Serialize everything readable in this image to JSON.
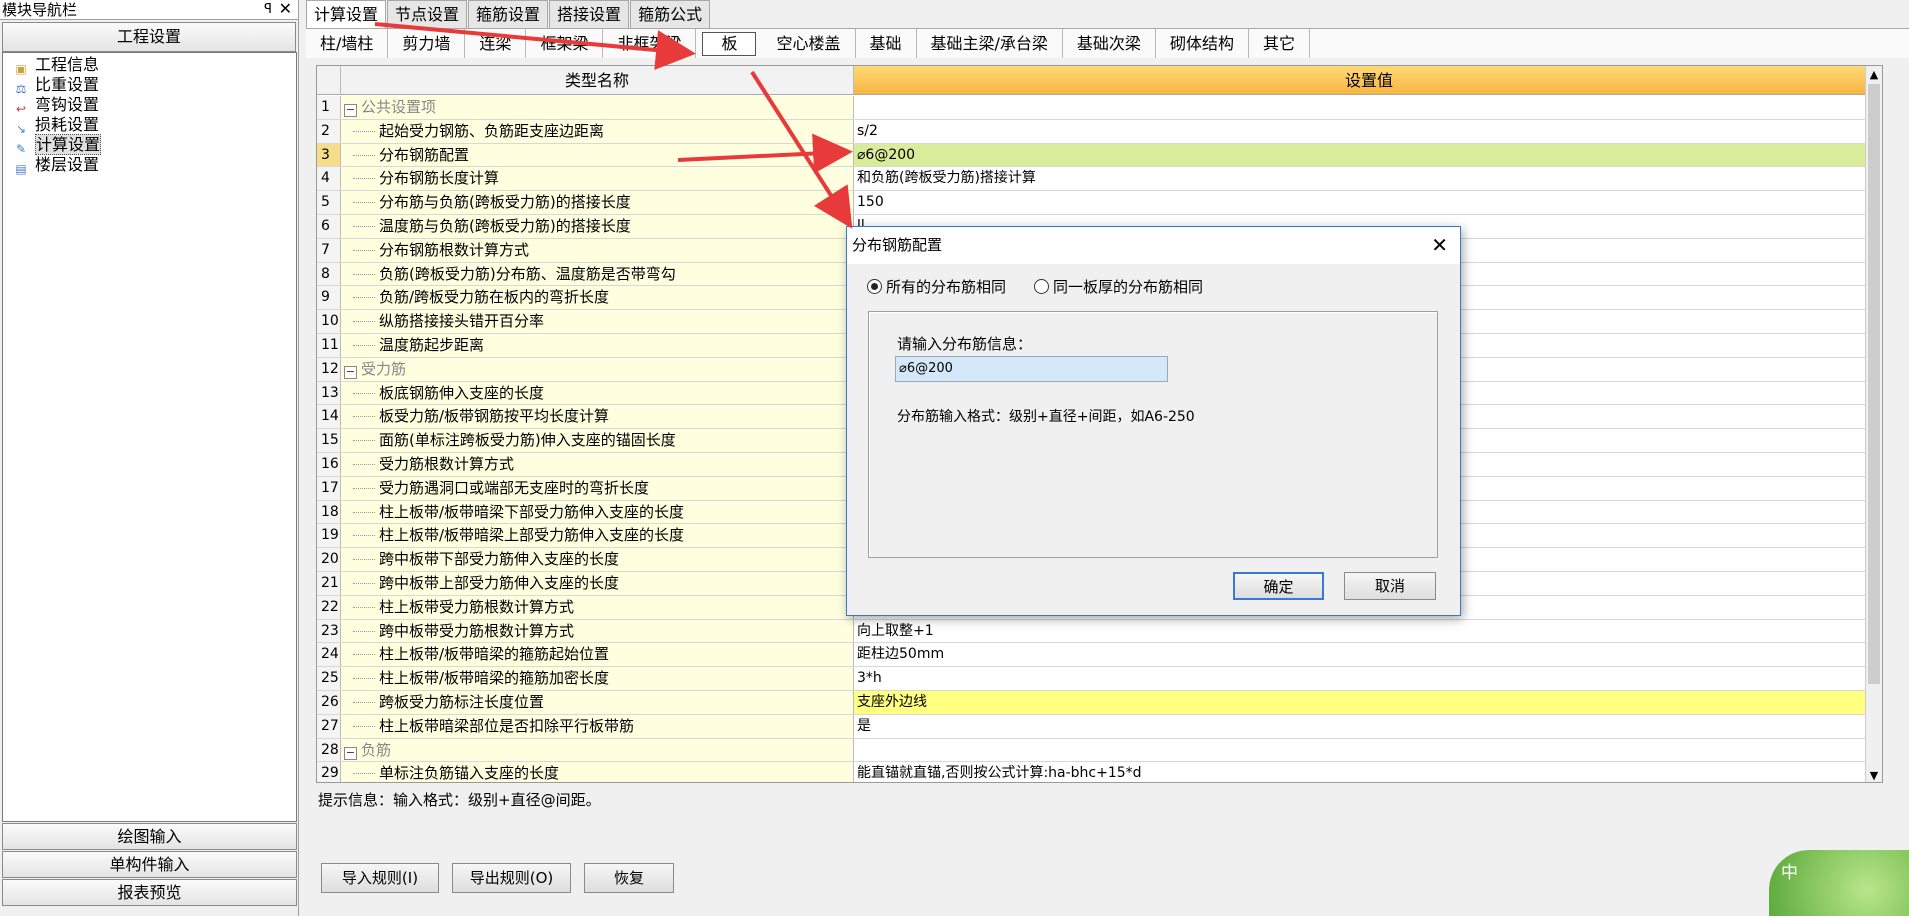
{
  "nav": {
    "title": "模块导航栏",
    "pin": "ꟼ",
    "close": "✕",
    "section": "工程设置",
    "items": [
      {
        "label": "工程信息",
        "icon": "project-info-icon"
      },
      {
        "label": "比重设置",
        "icon": "weight-setting-icon"
      },
      {
        "label": "弯钩设置",
        "icon": "hook-setting-icon"
      },
      {
        "label": "损耗设置",
        "icon": "loss-setting-icon"
      },
      {
        "label": "计算设置",
        "icon": "calc-setting-icon"
      },
      {
        "label": "楼层设置",
        "icon": "floor-setting-icon"
      }
    ],
    "footer": [
      "绘图输入",
      "单构件输入",
      "报表预览"
    ]
  },
  "tabs1": [
    "计算设置",
    "节点设置",
    "箍筋设置",
    "搭接设置",
    "箍筋公式"
  ],
  "tabs2": [
    "柱/墙柱",
    "剪力墙",
    "连梁",
    "框架梁",
    "非框架梁",
    "板",
    "空心楼盖",
    "基础",
    "基础主梁/承台梁",
    "基础次梁",
    "砌体结构",
    "其它"
  ],
  "grid": {
    "col_name": "类型名称",
    "col_value": "设置值",
    "rows": [
      {
        "n": "1",
        "name": "公共设置项",
        "group": true,
        "value": ""
      },
      {
        "n": "2",
        "name": "起始受力钢筋、负筋距支座边距离",
        "value": "s/2"
      },
      {
        "n": "3",
        "name": "分布钢筋配置",
        "value": "⌀6@200",
        "sel": true
      },
      {
        "n": "4",
        "name": "分布钢筋长度计算",
        "value": "和负筋(跨板受力筋)搭接计算"
      },
      {
        "n": "5",
        "name": "分布筋与负筋(跨板受力筋)的搭接长度",
        "value": "150"
      },
      {
        "n": "6",
        "name": "温度筋与负筋(跨板受力筋)的搭接长度",
        "value": "ll"
      },
      {
        "n": "7",
        "name": "分布钢筋根数计算方式",
        "value": ""
      },
      {
        "n": "8",
        "name": "负筋(跨板受力筋)分布筋、温度筋是否带弯勾",
        "value": ""
      },
      {
        "n": "9",
        "name": "负筋/跨板受力筋在板内的弯折长度",
        "value": ""
      },
      {
        "n": "10",
        "name": "纵筋搭接接头错开百分率",
        "value": ""
      },
      {
        "n": "11",
        "name": "温度筋起步距离",
        "value": ""
      },
      {
        "n": "12",
        "name": "受力筋",
        "group": true,
        "value": ""
      },
      {
        "n": "13",
        "name": "板底钢筋伸入支座的长度",
        "value": ""
      },
      {
        "n": "14",
        "name": "板受力筋/板带钢筋按平均长度计算",
        "value": ""
      },
      {
        "n": "15",
        "name": "面筋(单标注跨板受力筋)伸入支座的锚固长度",
        "value": ""
      },
      {
        "n": "16",
        "name": "受力筋根数计算方式",
        "value": ""
      },
      {
        "n": "17",
        "name": "受力筋遇洞口或端部无支座时的弯折长度",
        "value": ""
      },
      {
        "n": "18",
        "name": "柱上板带/板带暗梁下部受力筋伸入支座的长度",
        "value": ""
      },
      {
        "n": "19",
        "name": "柱上板带/板带暗梁上部受力筋伸入支座的长度",
        "value": ""
      },
      {
        "n": "20",
        "name": "跨中板带下部受力筋伸入支座的长度",
        "value": ""
      },
      {
        "n": "21",
        "name": "跨中板带上部受力筋伸入支座的长度",
        "value": ""
      },
      {
        "n": "22",
        "name": "柱上板带受力筋根数计算方式",
        "value": ""
      },
      {
        "n": "23",
        "name": "跨中板带受力筋根数计算方式",
        "value": "向上取整+1"
      },
      {
        "n": "24",
        "name": "柱上板带/板带暗梁的箍筋起始位置",
        "value": "距柱边50mm"
      },
      {
        "n": "25",
        "name": "柱上板带/板带暗梁的箍筋加密长度",
        "value": "3*h"
      },
      {
        "n": "26",
        "name": "跨板受力筋标注长度位置",
        "value": "支座外边线",
        "hl": true
      },
      {
        "n": "27",
        "name": "柱上板带暗梁部位是否扣除平行板带筋",
        "value": "是"
      },
      {
        "n": "28",
        "name": "负筋",
        "group": true,
        "value": ""
      },
      {
        "n": "29",
        "name": "单标注负筋锚入支座的长度",
        "value": "能直锚就直锚,否则按公式计算:ha-bhc+15*d"
      }
    ]
  },
  "hint": "提示信息：输入格式：级别+直径@间距。",
  "buttons": {
    "import": "导入规则(I)",
    "export": "导出规则(O)",
    "restore": "恢复"
  },
  "dialog": {
    "title": "分布钢筋配置",
    "radio1": "所有的分布筋相同",
    "radio2": "同一板厚的分布筋相同",
    "prompt": "请输入分布筋信息：",
    "input": "⌀6@200",
    "format": "分布筋输入格式：级别+直径+间距，如A6-250",
    "ok": "确定",
    "cancel": "取消"
  },
  "corner_text": "中",
  "colors": {
    "arrow": "#e83a3a",
    "header": "#f7b640",
    "selected": "#d9ec9a",
    "highlight": "#ffff80"
  }
}
